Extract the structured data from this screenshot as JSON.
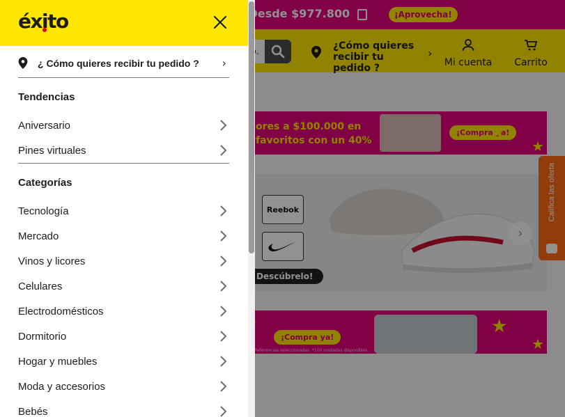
{
  "promo": {
    "text": "o Desde $977.800",
    "cta": "¡Aprovecha!"
  },
  "header": {
    "delivery_line1": "¿Cómo quieres",
    "delivery_line2": "recibir tu pedido ?",
    "account_label": "Mi cuenta",
    "cart_label": "Carrito",
    "search_partial": "o."
  },
  "banners": {
    "banner1_line1": "ores a $100.000 en",
    "banner1_line2": "favoritos con un 40%",
    "banner1_cta": "¡Compra ya!",
    "discover_label": "Descúbrelo!",
    "brand1": "Reebok",
    "banner3_cta": "¡Compra ya!",
    "banner3_fine": "Referencias seleccionadas. *100 unidades disponibles.",
    "banner3_partial": "s"
  },
  "rating_tab": {
    "label": "Califica las oferta"
  },
  "drawer": {
    "logo": "éxito",
    "delivery_label": "¿ Cómo quieres recibir tu pedido ?",
    "trends_title": "Tendencias",
    "trends": [
      {
        "label": "Aniversario"
      },
      {
        "label": "Pines virtuales"
      }
    ],
    "categories_title": "Categorías",
    "categories": [
      {
        "label": "Tecnología"
      },
      {
        "label": "Mercado"
      },
      {
        "label": "Vinos y licores"
      },
      {
        "label": "Celulares"
      },
      {
        "label": "Electrodomésticos"
      },
      {
        "label": "Dormitorio"
      },
      {
        "label": "Hogar y muebles"
      },
      {
        "label": "Moda y accesorios"
      },
      {
        "label": "Bebés"
      }
    ]
  },
  "colors": {
    "brand_yellow": "#ffe600",
    "brand_magenta": "#e4007c",
    "rating_orange": "#ff6a13",
    "text_dark": "#1d1d1b"
  }
}
